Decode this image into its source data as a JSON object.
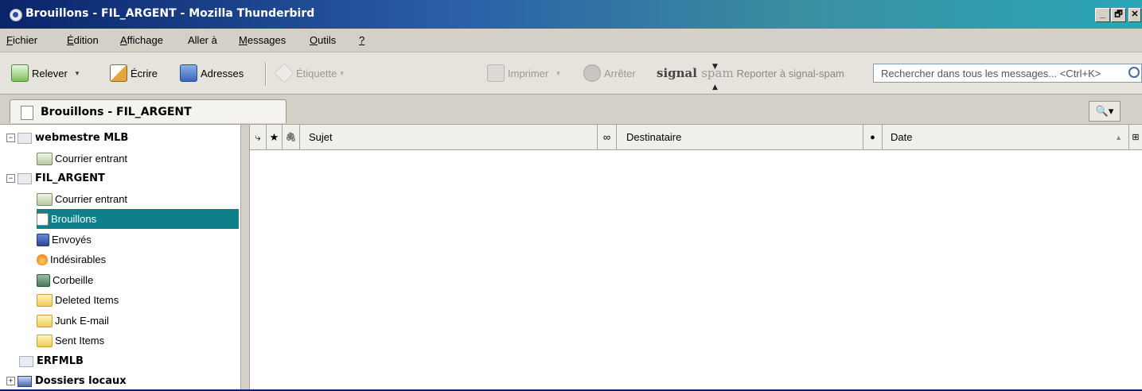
{
  "window": {
    "title": "Brouillons - FIL_ARGENT - Mozilla Thunderbird",
    "controls": {
      "minimize": "_",
      "maximize": "🗗",
      "close": "✕"
    }
  },
  "menubar": [
    {
      "label": "Fichier",
      "accel": "F",
      "rest": "ichier"
    },
    {
      "label": "Édition",
      "accel": "É",
      "rest": "dition"
    },
    {
      "label": "Affichage",
      "accel": "A",
      "rest": "ffichage"
    },
    {
      "label": "Aller à",
      "accel": "",
      "rest": "Aller à"
    },
    {
      "label": "Messages",
      "accel": "M",
      "rest": "essages"
    },
    {
      "label": "Outils",
      "accel": "O",
      "rest": "utils"
    },
    {
      "label": "?",
      "accel": "?",
      "rest": ""
    }
  ],
  "toolbar": {
    "relever": "Relever",
    "ecrire": "Écrire",
    "adresses": "Adresses",
    "etiquette": "Étiquette",
    "imprimer": "Imprimer",
    "arreter": "Arrêter",
    "signal_logo_a": "signal",
    "signal_logo_b": "spam",
    "reporter": "Reporter à signal-spam",
    "search_placeholder": "Rechercher dans tous les messages... <Ctrl+K>",
    "dropdown_glyph": "▾"
  },
  "tab": {
    "label": "Brouillons - FIL_ARGENT",
    "search_button": "🔍▾"
  },
  "folders": [
    {
      "label": "webmestre MLB",
      "type": "account",
      "expander": "−",
      "bold": true
    },
    {
      "label": "Courrier entrant",
      "type": "inbox",
      "indent": 1
    },
    {
      "label": "FIL_ARGENT",
      "type": "account",
      "expander": "−",
      "bold": true
    },
    {
      "label": "Courrier entrant",
      "type": "inbox",
      "indent": 1
    },
    {
      "label": "Brouillons",
      "type": "drafts",
      "indent": 1,
      "selected": true
    },
    {
      "label": "Envoyés",
      "type": "sent",
      "indent": 1
    },
    {
      "label": "Indésirables",
      "type": "junk",
      "indent": 1
    },
    {
      "label": "Corbeille",
      "type": "trash",
      "indent": 1
    },
    {
      "label": "Deleted Items",
      "type": "folder",
      "indent": 1
    },
    {
      "label": "Junk E-mail",
      "type": "folder",
      "indent": 1
    },
    {
      "label": "Sent Items",
      "type": "folder",
      "indent": 1
    },
    {
      "label": "ERFMLB",
      "type": "account",
      "expander": "",
      "bold": true
    },
    {
      "label": "Dossiers locaux",
      "type": "local",
      "expander": "+",
      "bold": true
    }
  ],
  "columns": {
    "thread_glyph": "⤷",
    "star_glyph": "★",
    "attach_glyph": "🖇",
    "subject": "Sujet",
    "junk_glyph": "∞",
    "recipient": "Destinataire",
    "status_glyph": "●",
    "date": "Date",
    "sort_glyph": "▲",
    "picker_glyph": "⊞"
  },
  "colors": {
    "selection": "#0f7f8a",
    "titlebar_start": "#0a246a",
    "titlebar_end": "#2aa6b8"
  }
}
